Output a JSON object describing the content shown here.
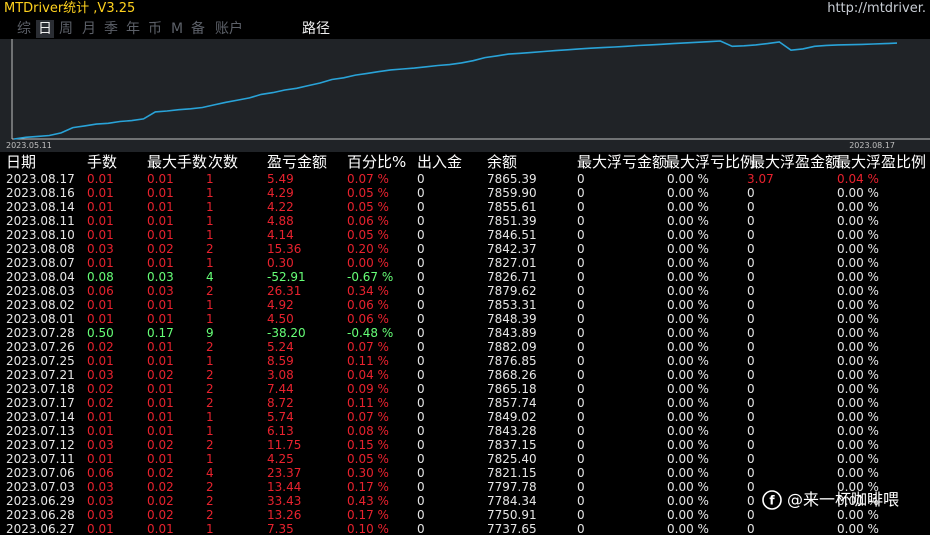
{
  "app": {
    "title": "MTDriver统计 ,V3.25",
    "url": "http://mtdriver."
  },
  "tabs": [
    "综",
    "日",
    "周",
    "月",
    "季",
    "年",
    "币",
    "M",
    "备",
    "账户"
  ],
  "active_tab": "日",
  "path_tab": "路径",
  "chart_data": {
    "type": "line",
    "x_start_label": "2023.05.11",
    "x_end_label": "2023.08.17",
    "color": "#29a3d8",
    "values": [
      6770,
      6790,
      6800,
      6810,
      6840,
      6900,
      6920,
      6940,
      6950,
      6970,
      6980,
      7000,
      7080,
      7090,
      7105,
      7115,
      7130,
      7160,
      7190,
      7215,
      7240,
      7280,
      7300,
      7330,
      7350,
      7380,
      7410,
      7450,
      7470,
      7500,
      7520,
      7540,
      7560,
      7570,
      7580,
      7595,
      7610,
      7620,
      7640,
      7665,
      7700,
      7720,
      7740,
      7750,
      7760,
      7770,
      7780,
      7790,
      7800,
      7808,
      7815,
      7822,
      7830,
      7838,
      7845,
      7852,
      7860,
      7868,
      7875,
      7882,
      7890,
      7830,
      7835,
      7845,
      7860,
      7880,
      7785,
      7800,
      7830,
      7840,
      7845,
      7848,
      7851,
      7856,
      7860,
      7866
    ]
  },
  "table": {
    "headers": [
      "日期",
      "手数",
      "最大手数",
      "次数",
      "盈亏金额",
      "百分比%",
      "出入金",
      "余额",
      "最大浮亏金额",
      "最大浮亏比例",
      "最大浮盈金额",
      "最大浮盈比例"
    ],
    "rows": [
      {
        "date": "2023.08.17",
        "lots": "0.01",
        "max_lots": "0.01",
        "count": "1",
        "pl": "5.49",
        "pct": "0.07 %",
        "io": "0",
        "bal": "7865.39",
        "mfl": "0",
        "mflp": "0.00 %",
        "mfp": "3.07",
        "mfpp": "0.04 %",
        "s": "red",
        "hi": true
      },
      {
        "date": "2023.08.16",
        "lots": "0.01",
        "max_lots": "0.01",
        "count": "1",
        "pl": "4.29",
        "pct": "0.05 %",
        "io": "0",
        "bal": "7859.90",
        "mfl": "0",
        "mflp": "0.00 %",
        "mfp": "0",
        "mfpp": "0.00 %",
        "s": "red",
        "hi": false
      },
      {
        "date": "2023.08.14",
        "lots": "0.01",
        "max_lots": "0.01",
        "count": "1",
        "pl": "4.22",
        "pct": "0.05 %",
        "io": "0",
        "bal": "7855.61",
        "mfl": "0",
        "mflp": "0.00 %",
        "mfp": "0",
        "mfpp": "0.00 %",
        "s": "red",
        "hi": false
      },
      {
        "date": "2023.08.11",
        "lots": "0.01",
        "max_lots": "0.01",
        "count": "1",
        "pl": "4.88",
        "pct": "0.06 %",
        "io": "0",
        "bal": "7851.39",
        "mfl": "0",
        "mflp": "0.00 %",
        "mfp": "0",
        "mfpp": "0.00 %",
        "s": "red",
        "hi": false
      },
      {
        "date": "2023.08.10",
        "lots": "0.01",
        "max_lots": "0.01",
        "count": "1",
        "pl": "4.14",
        "pct": "0.05 %",
        "io": "0",
        "bal": "7846.51",
        "mfl": "0",
        "mflp": "0.00 %",
        "mfp": "0",
        "mfpp": "0.00 %",
        "s": "red",
        "hi": false
      },
      {
        "date": "2023.08.08",
        "lots": "0.03",
        "max_lots": "0.02",
        "count": "2",
        "pl": "15.36",
        "pct": "0.20 %",
        "io": "0",
        "bal": "7842.37",
        "mfl": "0",
        "mflp": "0.00 %",
        "mfp": "0",
        "mfpp": "0.00 %",
        "s": "red",
        "hi": false
      },
      {
        "date": "2023.08.07",
        "lots": "0.01",
        "max_lots": "0.01",
        "count": "1",
        "pl": "0.30",
        "pct": "0.00 %",
        "io": "0",
        "bal": "7827.01",
        "mfl": "0",
        "mflp": "0.00 %",
        "mfp": "0",
        "mfpp": "0.00 %",
        "s": "red",
        "hi": false
      },
      {
        "date": "2023.08.04",
        "lots": "0.08",
        "max_lots": "0.03",
        "count": "4",
        "pl": "-52.91",
        "pct": "-0.67 %",
        "io": "0",
        "bal": "7826.71",
        "mfl": "0",
        "mflp": "0.00 %",
        "mfp": "0",
        "mfpp": "0.00 %",
        "s": "green",
        "hi": false
      },
      {
        "date": "2023.08.03",
        "lots": "0.06",
        "max_lots": "0.03",
        "count": "2",
        "pl": "26.31",
        "pct": "0.34 %",
        "io": "0",
        "bal": "7879.62",
        "mfl": "0",
        "mflp": "0.00 %",
        "mfp": "0",
        "mfpp": "0.00 %",
        "s": "red",
        "hi": false
      },
      {
        "date": "2023.08.02",
        "lots": "0.01",
        "max_lots": "0.01",
        "count": "1",
        "pl": "4.92",
        "pct": "0.06 %",
        "io": "0",
        "bal": "7853.31",
        "mfl": "0",
        "mflp": "0.00 %",
        "mfp": "0",
        "mfpp": "0.00 %",
        "s": "red",
        "hi": false
      },
      {
        "date": "2023.08.01",
        "lots": "0.01",
        "max_lots": "0.01",
        "count": "1",
        "pl": "4.50",
        "pct": "0.06 %",
        "io": "0",
        "bal": "7848.39",
        "mfl": "0",
        "mflp": "0.00 %",
        "mfp": "0",
        "mfpp": "0.00 %",
        "s": "red",
        "hi": false
      },
      {
        "date": "2023.07.28",
        "lots": "0.50",
        "max_lots": "0.17",
        "count": "9",
        "pl": "-38.20",
        "pct": "-0.48 %",
        "io": "0",
        "bal": "7843.89",
        "mfl": "0",
        "mflp": "0.00 %",
        "mfp": "0",
        "mfpp": "0.00 %",
        "s": "green",
        "hi": false
      },
      {
        "date": "2023.07.26",
        "lots": "0.02",
        "max_lots": "0.01",
        "count": "2",
        "pl": "5.24",
        "pct": "0.07 %",
        "io": "0",
        "bal": "7882.09",
        "mfl": "0",
        "mflp": "0.00 %",
        "mfp": "0",
        "mfpp": "0.00 %",
        "s": "red",
        "hi": false
      },
      {
        "date": "2023.07.25",
        "lots": "0.01",
        "max_lots": "0.01",
        "count": "1",
        "pl": "8.59",
        "pct": "0.11 %",
        "io": "0",
        "bal": "7876.85",
        "mfl": "0",
        "mflp": "0.00 %",
        "mfp": "0",
        "mfpp": "0.00 %",
        "s": "red",
        "hi": false
      },
      {
        "date": "2023.07.21",
        "lots": "0.03",
        "max_lots": "0.02",
        "count": "2",
        "pl": "3.08",
        "pct": "0.04 %",
        "io": "0",
        "bal": "7868.26",
        "mfl": "0",
        "mflp": "0.00 %",
        "mfp": "0",
        "mfpp": "0.00 %",
        "s": "red",
        "hi": false
      },
      {
        "date": "2023.07.18",
        "lots": "0.02",
        "max_lots": "0.01",
        "count": "2",
        "pl": "7.44",
        "pct": "0.09 %",
        "io": "0",
        "bal": "7865.18",
        "mfl": "0",
        "mflp": "0.00 %",
        "mfp": "0",
        "mfpp": "0.00 %",
        "s": "red",
        "hi": false
      },
      {
        "date": "2023.07.17",
        "lots": "0.02",
        "max_lots": "0.01",
        "count": "2",
        "pl": "8.72",
        "pct": "0.11 %",
        "io": "0",
        "bal": "7857.74",
        "mfl": "0",
        "mflp": "0.00 %",
        "mfp": "0",
        "mfpp": "0.00 %",
        "s": "red",
        "hi": false
      },
      {
        "date": "2023.07.14",
        "lots": "0.01",
        "max_lots": "0.01",
        "count": "1",
        "pl": "5.74",
        "pct": "0.07 %",
        "io": "0",
        "bal": "7849.02",
        "mfl": "0",
        "mflp": "0.00 %",
        "mfp": "0",
        "mfpp": "0.00 %",
        "s": "red",
        "hi": false
      },
      {
        "date": "2023.07.13",
        "lots": "0.01",
        "max_lots": "0.01",
        "count": "1",
        "pl": "6.13",
        "pct": "0.08 %",
        "io": "0",
        "bal": "7843.28",
        "mfl": "0",
        "mflp": "0.00 %",
        "mfp": "0",
        "mfpp": "0.00 %",
        "s": "red",
        "hi": false
      },
      {
        "date": "2023.07.12",
        "lots": "0.03",
        "max_lots": "0.02",
        "count": "2",
        "pl": "11.75",
        "pct": "0.15 %",
        "io": "0",
        "bal": "7837.15",
        "mfl": "0",
        "mflp": "0.00 %",
        "mfp": "0",
        "mfpp": "0.00 %",
        "s": "red",
        "hi": false
      },
      {
        "date": "2023.07.11",
        "lots": "0.01",
        "max_lots": "0.01",
        "count": "1",
        "pl": "4.25",
        "pct": "0.05 %",
        "io": "0",
        "bal": "7825.40",
        "mfl": "0",
        "mflp": "0.00 %",
        "mfp": "0",
        "mfpp": "0.00 %",
        "s": "red",
        "hi": false
      },
      {
        "date": "2023.07.06",
        "lots": "0.06",
        "max_lots": "0.02",
        "count": "4",
        "pl": "23.37",
        "pct": "0.30 %",
        "io": "0",
        "bal": "7821.15",
        "mfl": "0",
        "mflp": "0.00 %",
        "mfp": "0",
        "mfpp": "0.00 %",
        "s": "red",
        "hi": false
      },
      {
        "date": "2023.07.03",
        "lots": "0.03",
        "max_lots": "0.02",
        "count": "2",
        "pl": "13.44",
        "pct": "0.17 %",
        "io": "0",
        "bal": "7797.78",
        "mfl": "0",
        "mflp": "0.00 %",
        "mfp": "0",
        "mfpp": "0.00 %",
        "s": "red",
        "hi": false
      },
      {
        "date": "2023.06.29",
        "lots": "0.03",
        "max_lots": "0.02",
        "count": "2",
        "pl": "33.43",
        "pct": "0.43 %",
        "io": "0",
        "bal": "7784.34",
        "mfl": "0",
        "mflp": "0.00 %",
        "mfp": "0",
        "mfpp": "0.00 %",
        "s": "red",
        "hi": false
      },
      {
        "date": "2023.06.28",
        "lots": "0.03",
        "max_lots": "0.02",
        "count": "2",
        "pl": "13.26",
        "pct": "0.17 %",
        "io": "0",
        "bal": "7750.91",
        "mfl": "0",
        "mflp": "0.00 %",
        "mfp": "0",
        "mfpp": "0.00 %",
        "s": "red",
        "hi": false
      },
      {
        "date": "2023.06.27",
        "lots": "0.01",
        "max_lots": "0.01",
        "count": "1",
        "pl": "7.35",
        "pct": "0.10 %",
        "io": "0",
        "bal": "7737.65",
        "mfl": "0",
        "mflp": "0.00 %",
        "mfp": "0",
        "mfpp": "0.00 %",
        "s": "red",
        "hi": false
      }
    ]
  },
  "watermark": {
    "icon": "zhihu-logo-icon",
    "text": "@来一杯咖啡喂"
  },
  "colors": {
    "title": "#ffd21e",
    "profit": "#e8222e",
    "loss": "#66ff77",
    "line": "#29a3d8",
    "background": "#000000",
    "chart_bg": "#202327"
  }
}
